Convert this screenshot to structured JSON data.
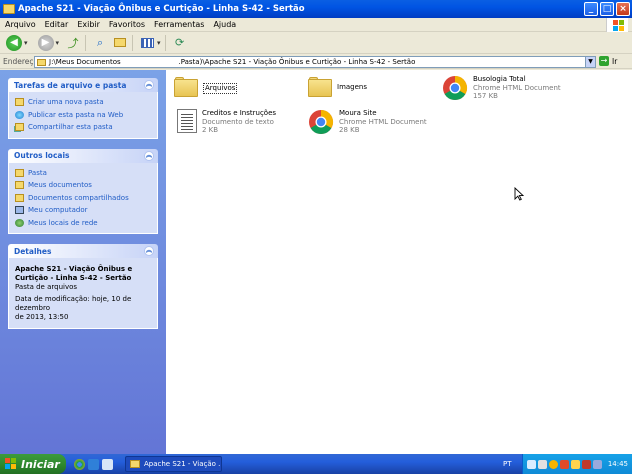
{
  "window": {
    "title": "Apache S21 - Viação Ônibus e Curtição - Linha S-42 - Sertão"
  },
  "menu": [
    "Arquivo",
    "Editar",
    "Exibir",
    "Favoritos",
    "Ferramentas",
    "Ajuda"
  ],
  "address": {
    "label": "Endereço",
    "value": "J:\\Meus Documentos                          .Pasta)\\Apache S21 - Viação Ônibus e Curtição - Linha S-42 - Sertão",
    "go_label": "Ir"
  },
  "panels": {
    "tasks": {
      "title": "Tarefas de arquivo e pasta",
      "items": [
        "Criar uma nova pasta",
        "Publicar esta pasta na Web",
        "Compartilhar esta pasta"
      ]
    },
    "places": {
      "title": "Outros locais",
      "items": [
        "Pasta",
        "Meus documentos",
        "Documentos compartilhados",
        "Meu computador",
        "Meus locais de rede"
      ]
    },
    "details": {
      "title": "Detalhes",
      "name_line1": "Apache S21 - Viação Ônibus e",
      "name_line2": "Curtição - Linha S-42 - Sertão",
      "type": "Pasta de arquivos",
      "modified_line1": "Data de modificação: hoje, 10 de dezembro",
      "modified_line2": "de 2013, 13:50"
    }
  },
  "files": [
    {
      "name": "Arquivos",
      "type": "",
      "size": "",
      "icon": "folder-icon"
    },
    {
      "name": "Imagens",
      "type": "",
      "size": "",
      "icon": "folder-icon"
    },
    {
      "name": "Busologia Total",
      "type": "Chrome HTML Document",
      "size": "157 KB",
      "icon": "chrome-icon"
    },
    {
      "name": "Creditos e Instruções",
      "type": "Documento de texto",
      "size": "2 KB",
      "icon": "text-document-icon"
    },
    {
      "name": "Moura Site",
      "type": "Chrome HTML Document",
      "size": "28 KB",
      "icon": "chrome-icon"
    }
  ],
  "taskbar": {
    "start_label": "Iniciar",
    "window_button": "Apache S21 - Viação ...",
    "language": "PT",
    "clock": "14:45"
  },
  "colors": {
    "titlebar": "#0054e3",
    "leftpane": "#6f8fe0",
    "taskbar": "#245edb",
    "start": "#2f8a2f",
    "link": "#215dc6"
  }
}
